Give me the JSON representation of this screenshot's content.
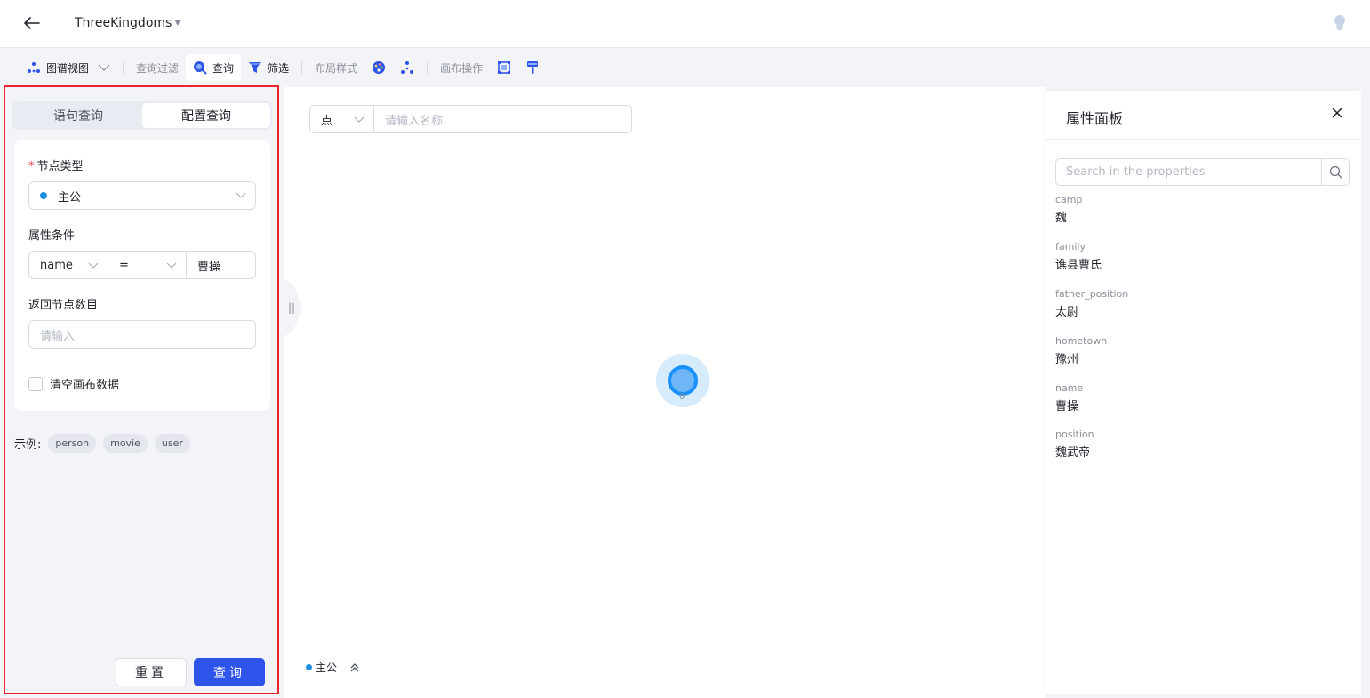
{
  "header": {
    "title": "ThreeKingdoms"
  },
  "toolbar": {
    "graph_view": "图谱视图",
    "query_filter": "查询过滤",
    "query": "查询",
    "filter": "筛选",
    "layout_style": "布局样式",
    "canvas_ops": "画布操作"
  },
  "left_panel": {
    "tabs": [
      "语句查询",
      "配置查询"
    ],
    "active_tab": 1,
    "node_type_label": "节点类型",
    "node_type_value": "主公",
    "prop_condition_label": "属性条件",
    "condition": {
      "prop": "name",
      "op": "=",
      "value": "曹操"
    },
    "return_count_label": "返回节点数目",
    "return_count_placeholder": "请输入",
    "clear_canvas_label": "清空画布数据",
    "examples_label": "示例:",
    "examples": [
      "person",
      "movie",
      "user"
    ],
    "reset_label": "重置",
    "query_label": "查询"
  },
  "canvas": {
    "search_type": "点",
    "search_placeholder": "请输入名称",
    "node_label": "0",
    "legend_label": "主公",
    "accent": "#1890ff"
  },
  "properties": {
    "title": "属性面板",
    "search_placeholder": "Search in the properties",
    "items": [
      {
        "key": "camp",
        "value": "魏"
      },
      {
        "key": "family",
        "value": "谯县曹氏"
      },
      {
        "key": "father_position",
        "value": "太尉"
      },
      {
        "key": "hometown",
        "value": "豫州"
      },
      {
        "key": "name",
        "value": "曹操"
      },
      {
        "key": "position",
        "value": "魏武帝"
      }
    ]
  }
}
